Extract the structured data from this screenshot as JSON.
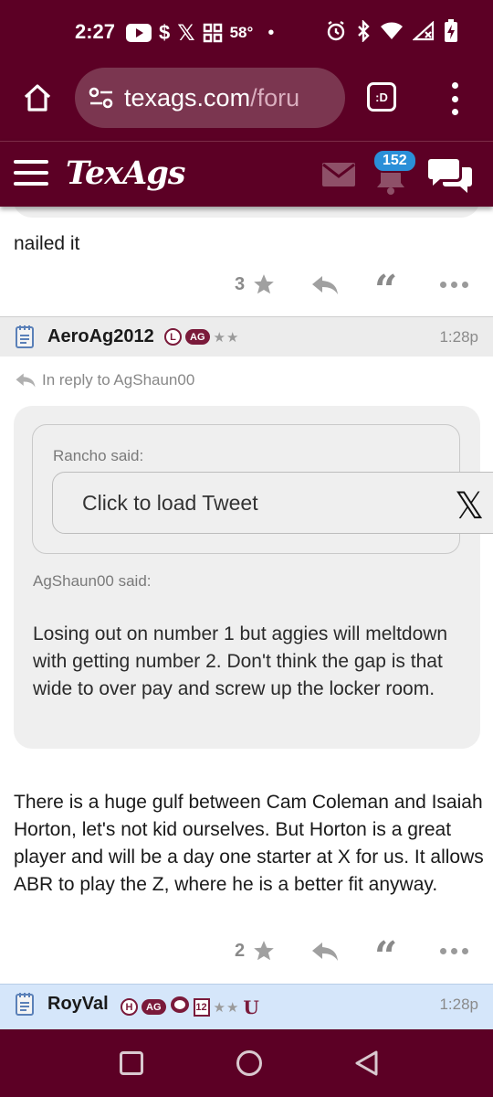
{
  "status_bar": {
    "time": "2:27",
    "temperature": "58°",
    "icons": [
      "youtube-icon",
      "dollar-icon",
      "x-icon",
      "grid-app-icon",
      "dot-icon",
      "alarm-icon",
      "bluetooth-icon",
      "wifi-icon",
      "signal-icon",
      "battery-charging-icon"
    ]
  },
  "browser": {
    "url_domain": "texags.com",
    "url_path": "/foru",
    "tab_label": ":D"
  },
  "site": {
    "logo": "TexAgs",
    "notification_count": "152"
  },
  "posts": [
    {
      "body": "nailed it",
      "star_count": "3"
    },
    {
      "username": "AeroAg2012",
      "badges": [
        "L",
        "AG"
      ],
      "stars": "★★",
      "time": "1:28p",
      "reply_to": "In reply to AgShaun00",
      "quote": {
        "inner_author": "Rancho said:",
        "tweet_prompt": "Click to load Tweet",
        "outer_author": "AgShaun00 said:",
        "text": "Losing out on number 1 but aggies will meltdown with getting number 2. Don't think the gap is that wide to over pay and screw up the locker room."
      },
      "body": "There is a huge gulf between Cam Coleman and Isaiah Horton, let's not kid ourselves. But Horton is a great player and will be a day one starter at X for us. It allows ABR to play the Z, where he is a better fit anyway.",
      "star_count": "2"
    },
    {
      "username": "RoyVal",
      "badges": [
        "H",
        "AG",
        "12"
      ],
      "stars": "★★",
      "time": "1:28p"
    }
  ],
  "colors": {
    "maroon": "#5c0025",
    "badge_blue": "#2a8fd8",
    "highlight_row": "#d5e6fa"
  }
}
